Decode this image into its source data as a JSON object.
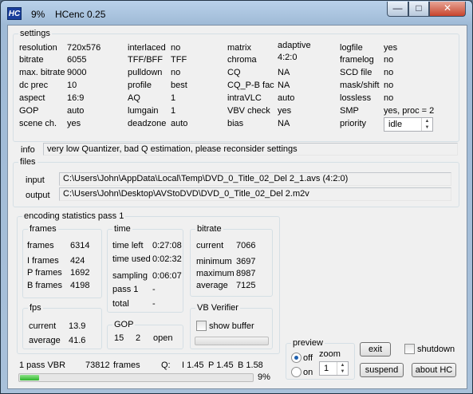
{
  "window": {
    "app_icon": "HC",
    "title_percent": "9%",
    "title": "HCenc 0.25",
    "icons": {
      "minimize": "minimize-icon",
      "maximize": "maximize-icon",
      "close": "close-icon"
    }
  },
  "settings": {
    "title": "settings",
    "col1": [
      {
        "label": "resolution",
        "value": "720x576"
      },
      {
        "label": "bitrate",
        "value": "6055"
      },
      {
        "label": "max. bitrate",
        "value": "9000"
      },
      {
        "label": "dc prec",
        "value": "10"
      },
      {
        "label": "aspect",
        "value": "16:9"
      },
      {
        "label": "GOP",
        "value": "auto"
      },
      {
        "label": "scene ch.",
        "value": "yes"
      }
    ],
    "col2": [
      {
        "label": "interlaced",
        "value": "no"
      },
      {
        "label": "TFF/BFF",
        "value": "TFF"
      },
      {
        "label": "pulldown",
        "value": "no"
      },
      {
        "label": "profile",
        "value": "best"
      },
      {
        "label": "AQ",
        "value": "1"
      },
      {
        "label": "lumgain",
        "value": "1"
      },
      {
        "label": "deadzone",
        "value": "auto"
      }
    ],
    "col3": [
      {
        "label": "matrix",
        "value": "adaptive"
      },
      {
        "label": "chroma",
        "value": "4:2:0"
      },
      {
        "label": "CQ",
        "value": "NA"
      },
      {
        "label": "CQ_P-B fac",
        "value": "NA"
      },
      {
        "label": "intraVLC",
        "value": "auto"
      },
      {
        "label": "VBV check",
        "value": "yes"
      },
      {
        "label": "bias",
        "value": "NA"
      }
    ],
    "col4": [
      {
        "label": "logfile",
        "value": "yes"
      },
      {
        "label": "framelog",
        "value": "no"
      },
      {
        "label": "SCD file",
        "value": "no"
      },
      {
        "label": "mask/shift",
        "value": "no"
      },
      {
        "label": "lossless",
        "value": "no"
      },
      {
        "label": "SMP",
        "value": "yes,  proc = 2"
      },
      {
        "label": "priority",
        "value": "idle"
      }
    ]
  },
  "info": {
    "label": "info",
    "text": "very low Quantizer, bad Q estimation, please reconsider settings"
  },
  "files": {
    "title": "files",
    "input_label": "input",
    "input_value": "C:\\Users\\John\\AppData\\Local\\Temp\\DVD_0_Title_02_Del 2_1.avs   (4:2:0)",
    "output_label": "output",
    "output_value": "C:\\Users\\John\\Desktop\\AVStoDVD\\DVD_0_Title_02_Del 2.m2v"
  },
  "stats": {
    "title": "encoding statistics pass 1",
    "frames": {
      "title": "frames",
      "rows": [
        {
          "label": "frames",
          "value": "6314"
        },
        {
          "label": "I frames",
          "value": "424"
        },
        {
          "label": "P frames",
          "value": "1692"
        },
        {
          "label": "B frames",
          "value": "4198"
        }
      ]
    },
    "time": {
      "title": "time",
      "rows": [
        {
          "label": "time left",
          "value": "0:27:08"
        },
        {
          "label": "time used",
          "value": "0:02:32"
        },
        {
          "label": "sampling",
          "value": "0:06:07"
        },
        {
          "label": "pass 1",
          "value": "-"
        },
        {
          "label": "total",
          "value": "-"
        }
      ]
    },
    "bitrate": {
      "title": "bitrate",
      "rows": [
        {
          "label": "current",
          "value": "7066"
        },
        {
          "label": "minimum",
          "value": "3697"
        },
        {
          "label": "maximum",
          "value": "8987"
        },
        {
          "label": "average",
          "value": "7125"
        }
      ]
    },
    "fps": {
      "title": "fps",
      "rows": [
        {
          "label": "current",
          "value": "13.9"
        },
        {
          "label": "average",
          "value": "41.6"
        }
      ]
    },
    "gop": {
      "title": "GOP",
      "values": [
        "15",
        "2",
        "open"
      ]
    },
    "vb": {
      "title": "VB Verifier",
      "show_buffer_label": "show buffer",
      "show_buffer_checked": false
    }
  },
  "preview": {
    "title": "preview",
    "off_label": "off",
    "on_label": "on",
    "selected": "off",
    "zoom_label": "zoom",
    "zoom_value": "1"
  },
  "buttons": {
    "exit": "exit",
    "suspend": "suspend",
    "about": "about  HC",
    "shutdown_label": "shutdown",
    "shutdown_checked": false
  },
  "status": {
    "pass": "1 pass VBR",
    "frames_count": "73812",
    "frames_label": "frames",
    "q_label": "Q:",
    "q_i": "I 1.45",
    "q_p": "P 1.45",
    "q_b": "B 1.58",
    "progress_percent": 9,
    "progress_text": "9%"
  },
  "colors": {
    "progress_green": "#2eb52b",
    "close_red": "#c7442c",
    "icon_blue": "#1b3f9c"
  }
}
